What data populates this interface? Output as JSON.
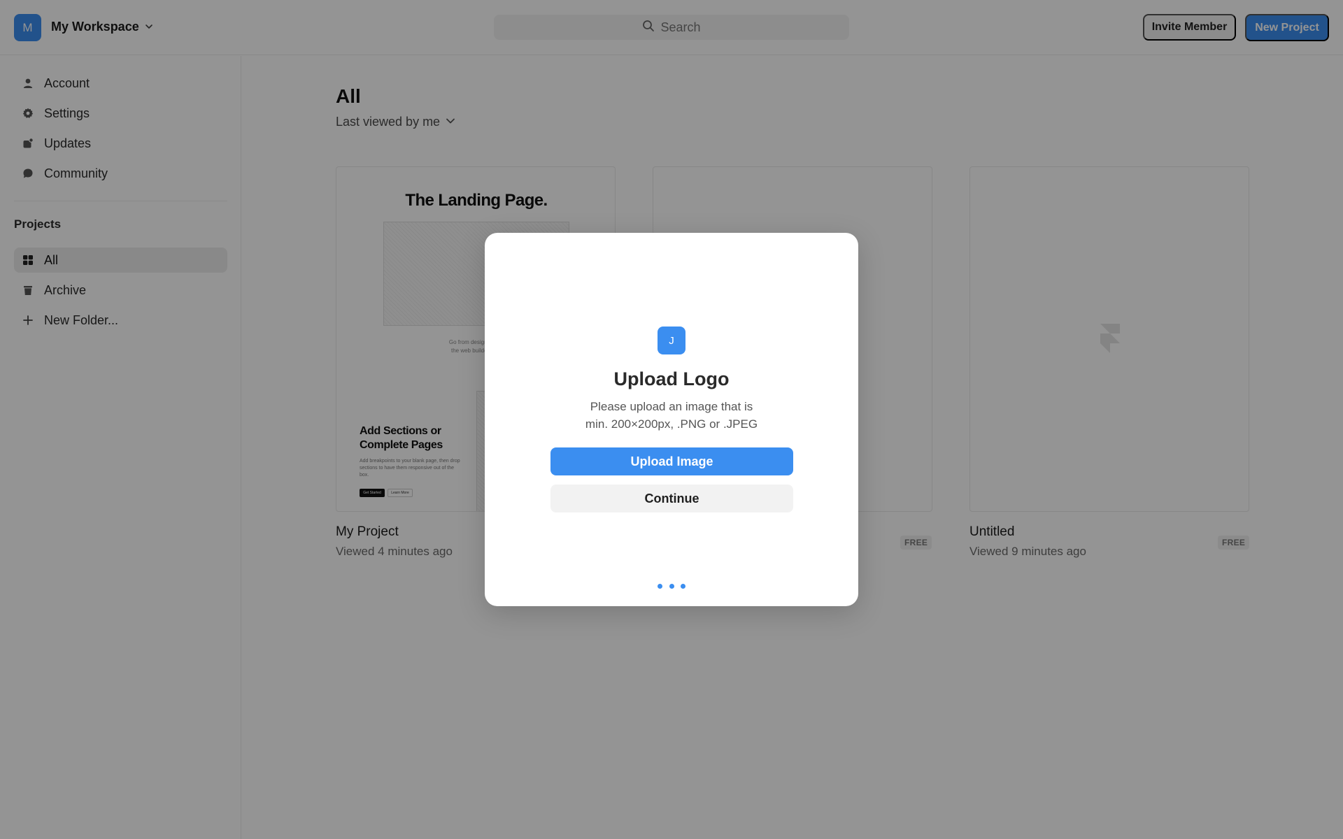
{
  "topbar": {
    "workspace_initial": "M",
    "workspace_name": "My Workspace",
    "search_placeholder": "Search",
    "invite_label": "Invite Member",
    "new_project_label": "New Project"
  },
  "sidebar": {
    "nav": [
      {
        "label": "Account",
        "icon": "user-icon"
      },
      {
        "label": "Settings",
        "icon": "gear-icon"
      },
      {
        "label": "Updates",
        "icon": "updates-icon"
      },
      {
        "label": "Community",
        "icon": "chat-bubble-icon"
      }
    ],
    "projects_heading": "Projects",
    "projects": [
      {
        "label": "All",
        "icon": "grid-icon",
        "active": true
      },
      {
        "label": "Archive",
        "icon": "trash-icon"
      },
      {
        "label": "New Folder...",
        "icon": "plus-icon"
      }
    ]
  },
  "main": {
    "title": "All",
    "sort_label": "Last viewed by me",
    "cards": [
      {
        "title": "My Project",
        "meta": "Viewed 4 minutes ago",
        "badge": "",
        "thumb": {
          "heading": "The Landing Page.",
          "tagline_1": "Go from design to site",
          "tagline_2": "the web builder for c",
          "section_title": "Add Sections or Complete Pages",
          "section_body": "Add breakpoints to your blank page, then drop sections to have them responsive out of the box.",
          "primary_cta": "Get Started",
          "secondary_cta": "Learn More"
        }
      },
      {
        "title": "",
        "meta": "",
        "badge": "FREE"
      },
      {
        "title": "Untitled",
        "meta": "Viewed 9 minutes ago",
        "badge": "FREE"
      }
    ]
  },
  "modal": {
    "initial": "J",
    "title": "Upload Logo",
    "description_line1": "Please upload an image that is",
    "description_line2": "min. 200×200px, .PNG or .JPEG",
    "upload_label": "Upload Image",
    "continue_label": "Continue",
    "step_count": 3
  },
  "colors": {
    "accent": "#3b8ef0",
    "overlay": "rgba(0,0,0,0.42)"
  }
}
